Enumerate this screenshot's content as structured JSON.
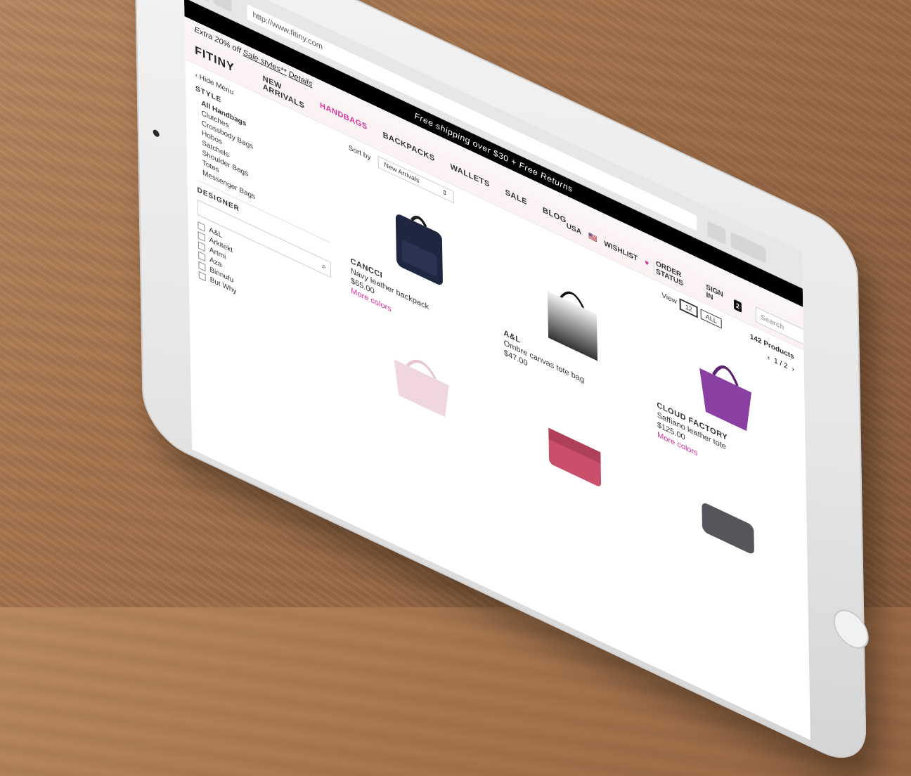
{
  "browser": {
    "url": "http://www.fitiny.com"
  },
  "banner": {
    "text": "Free shipping over $30 + Free Returns"
  },
  "promo": {
    "lead": "Extra 20% off ",
    "link": "Sale styles**",
    "details": "Details"
  },
  "header": {
    "logo": "FITINY",
    "nav": [
      "NEW ARRIVALS",
      "HANDBAGS",
      "BACKPACKS",
      "WALLETS",
      "SALE",
      "BLOG"
    ],
    "active_nav": "HANDBAGS",
    "country": "USA",
    "wishlist": "WISHLIST",
    "order_status": "ORDER STATUS",
    "sign_in": "SIGN IN",
    "bag_count": "2",
    "search_placeholder": "Search"
  },
  "sidebar": {
    "hide_menu": "Hide Menu",
    "style_heading": "STYLE",
    "style_items": [
      "All Handbags",
      "Clutches",
      "Crossbody Bags",
      "Hobos",
      "Satchels",
      "Shoulder Bags",
      "Totes",
      "Messenger Bags"
    ],
    "designer_heading": "DESIGNER",
    "designers": [
      "A&L",
      "Arkitekt",
      "Artmi",
      "Aza",
      "Binnufu",
      "But Why"
    ]
  },
  "toolbar": {
    "sort_label": "Sort by",
    "sort_value": "New Arrivals",
    "view_label": "View",
    "view_options": [
      "12",
      "ALL"
    ],
    "product_count": "142 Products",
    "page": "1 / 2"
  },
  "products": [
    {
      "brand": "CANCCI",
      "name": "Navy leather backpack",
      "price": "$65.00",
      "more": "More colors",
      "color": "#1f2740"
    },
    {
      "brand": "A&L",
      "name": "Ombre canvas tote bag",
      "price": "$47.00",
      "more": "",
      "color": "#8a8a8a"
    },
    {
      "brand": "CLOUD FACTORY",
      "name": "Saffiano leather tote",
      "price": "$125.00",
      "more": "More colors",
      "color": "#8a3fa3"
    }
  ],
  "colors": {
    "accent": "#d6339b"
  }
}
